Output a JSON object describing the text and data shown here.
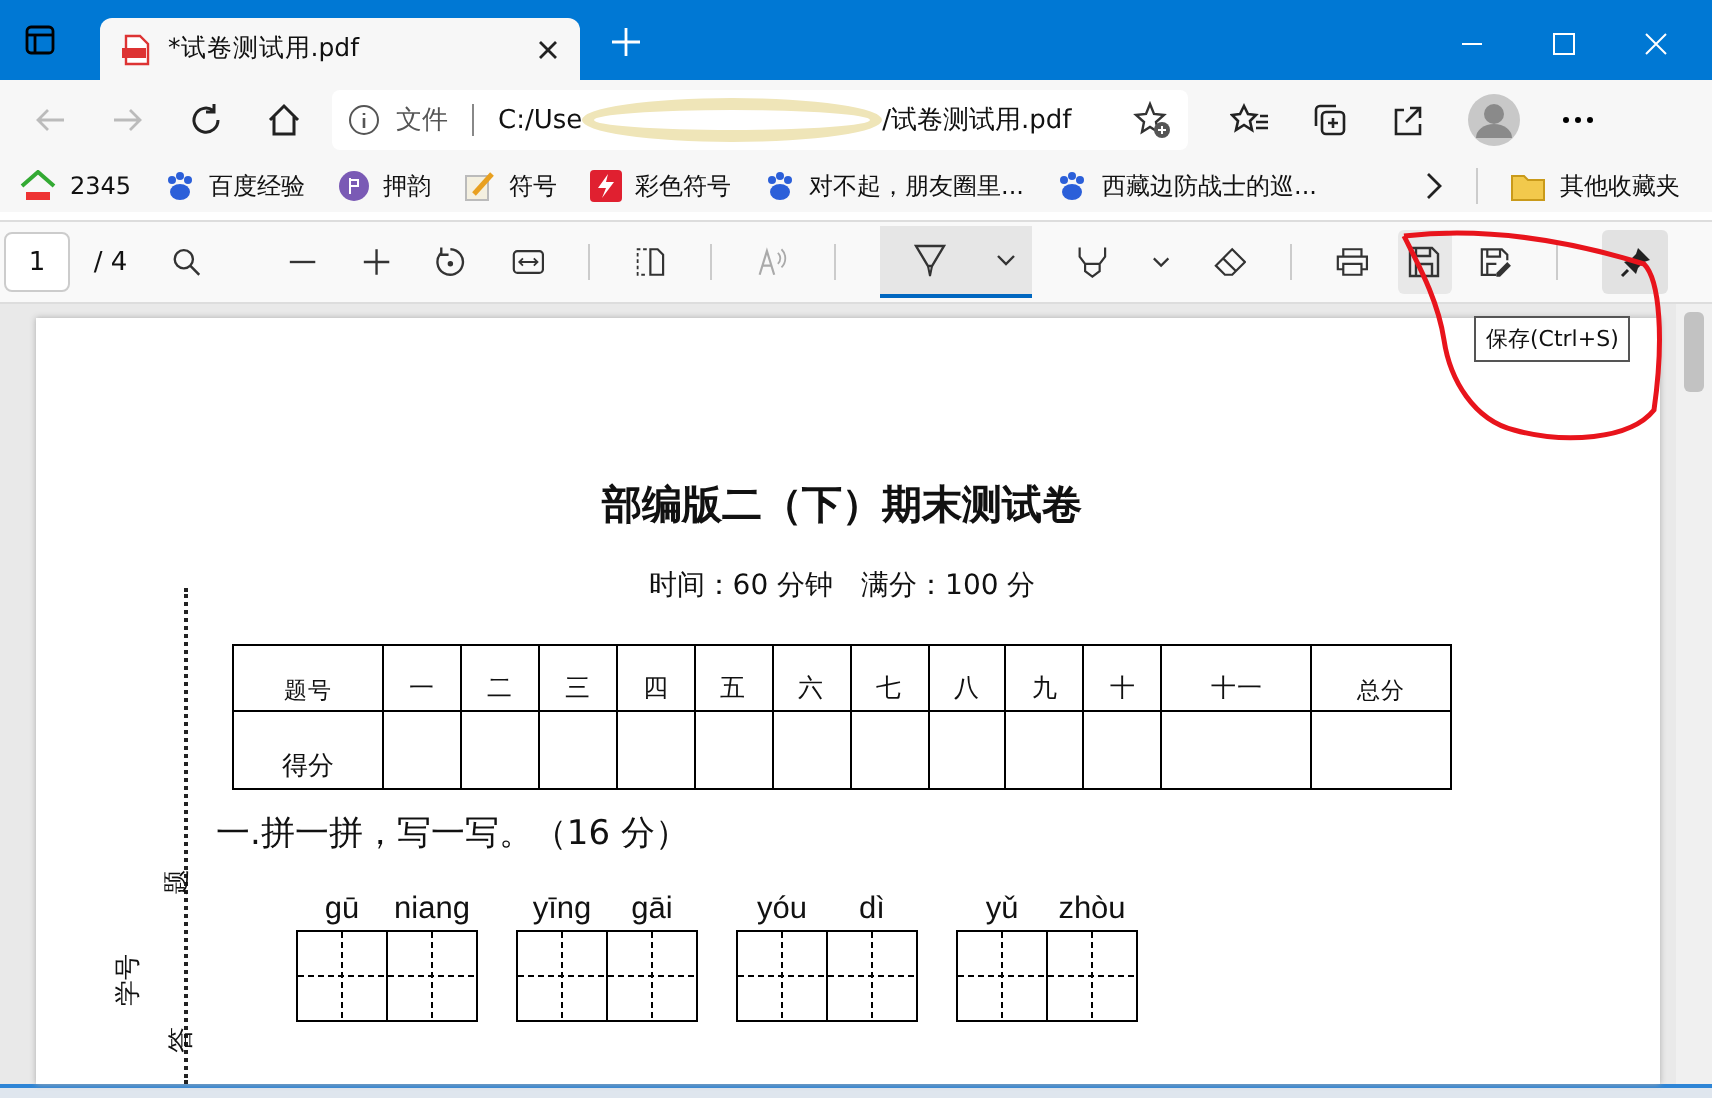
{
  "tab": {
    "title": "*试卷测试用.pdf",
    "selected": true
  },
  "address": {
    "scheme_label": "文件",
    "path_start": "C:/Use",
    "path_end": "/试卷测试用.pdf"
  },
  "bookmarks": [
    {
      "label": "2345",
      "kind": "house"
    },
    {
      "label": "百度经验",
      "kind": "paw"
    },
    {
      "label": "押韵",
      "kind": "circle"
    },
    {
      "label": "符号",
      "kind": "pencil"
    },
    {
      "label": "彩色符号",
      "kind": "bolt"
    },
    {
      "label": "对不起，朋友圈里...",
      "kind": "paw"
    },
    {
      "label": "西藏边防战士的巡...",
      "kind": "paw"
    }
  ],
  "other_bookmarks": "其他收藏夹",
  "pdf_toolbar": {
    "page": "1",
    "page_count": "/ 4",
    "draw_selected": true,
    "pin_on": true,
    "tooltip": "保存(Ctrl+S)"
  },
  "document": {
    "title": "部编版二（下）期末测试卷",
    "subtitle": "时间：60 分钟　满分：100 分",
    "score_table": {
      "header": [
        "题号",
        "一",
        "二",
        "三",
        "四",
        "五",
        "六",
        "七",
        "八",
        "九",
        "十",
        "十一",
        "总分"
      ],
      "row_label": "得分"
    },
    "side_labels": [
      "题",
      "学号",
      "答"
    ],
    "section": "一.拼一拼，写一写。（16 分）",
    "pinyin": [
      [
        "gū",
        "niang"
      ],
      [
        "yīng",
        "gāi"
      ],
      [
        "yóu",
        "dì"
      ],
      [
        "yǔ",
        "zhòu"
      ]
    ]
  }
}
